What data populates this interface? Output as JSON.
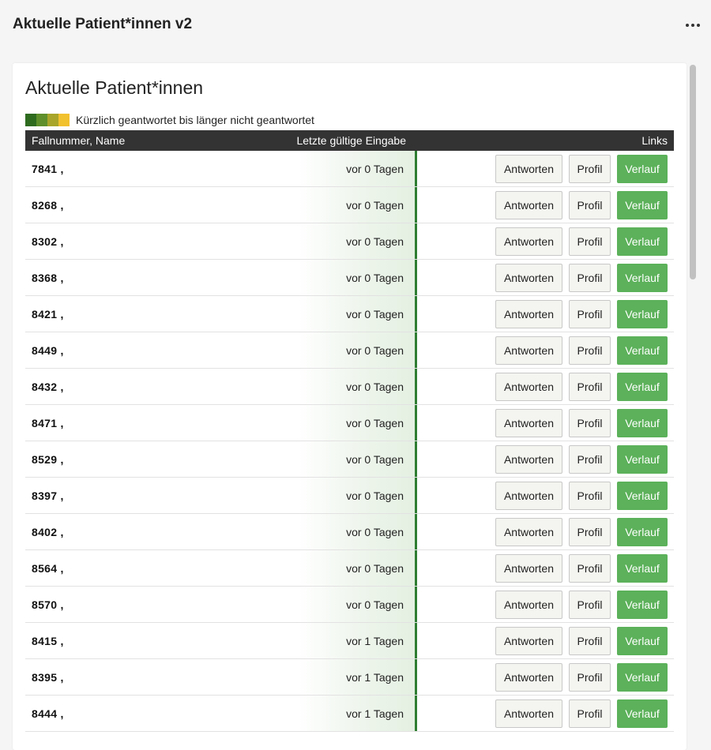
{
  "header": {
    "title": "Aktuelle Patient*innen v2",
    "menu_icon": "more-horizontal-icon"
  },
  "card": {
    "title": "Aktuelle Patient*innen",
    "legend": {
      "colors": [
        "#2e6b1f",
        "#5e8f2a",
        "#a8a52a",
        "#f2c12e"
      ],
      "text": "Kürzlich geantwortet bis länger nicht geantwortet"
    }
  },
  "table": {
    "columns": {
      "name": "Fallnummer, Name",
      "last": "Letzte gültige Eingabe",
      "links": "Links"
    },
    "buttons": {
      "answer": "Antworten",
      "profile": "Profil",
      "history": "Verlauf"
    },
    "rows": [
      {
        "name": "7841 ,",
        "last": "vor 0 Tagen"
      },
      {
        "name": "8268 ,",
        "last": "vor 0 Tagen"
      },
      {
        "name": "8302 ,",
        "last": "vor 0 Tagen"
      },
      {
        "name": "8368 ,",
        "last": "vor 0 Tagen"
      },
      {
        "name": "8421 ,",
        "last": "vor 0 Tagen"
      },
      {
        "name": "8449 ,",
        "last": "vor 0 Tagen"
      },
      {
        "name": "8432 ,",
        "last": "vor 0 Tagen"
      },
      {
        "name": "8471 ,",
        "last": "vor 0 Tagen"
      },
      {
        "name": "8529 ,",
        "last": "vor 0 Tagen"
      },
      {
        "name": "8397 ,",
        "last": "vor 0 Tagen"
      },
      {
        "name": "8402 ,",
        "last": "vor 0 Tagen"
      },
      {
        "name": "8564 ,",
        "last": "vor 0 Tagen"
      },
      {
        "name": "8570 ,",
        "last": "vor 0 Tagen"
      },
      {
        "name": "8415 ,",
        "last": "vor 1 Tagen"
      },
      {
        "name": "8395 ,",
        "last": "vor 1 Tagen"
      },
      {
        "name": "8444 ,",
        "last": "vor 1 Tagen"
      }
    ]
  },
  "colors": {
    "table_header": "#333333",
    "history_button": "#5cb15a",
    "recent_marker": "#2e7d32"
  }
}
